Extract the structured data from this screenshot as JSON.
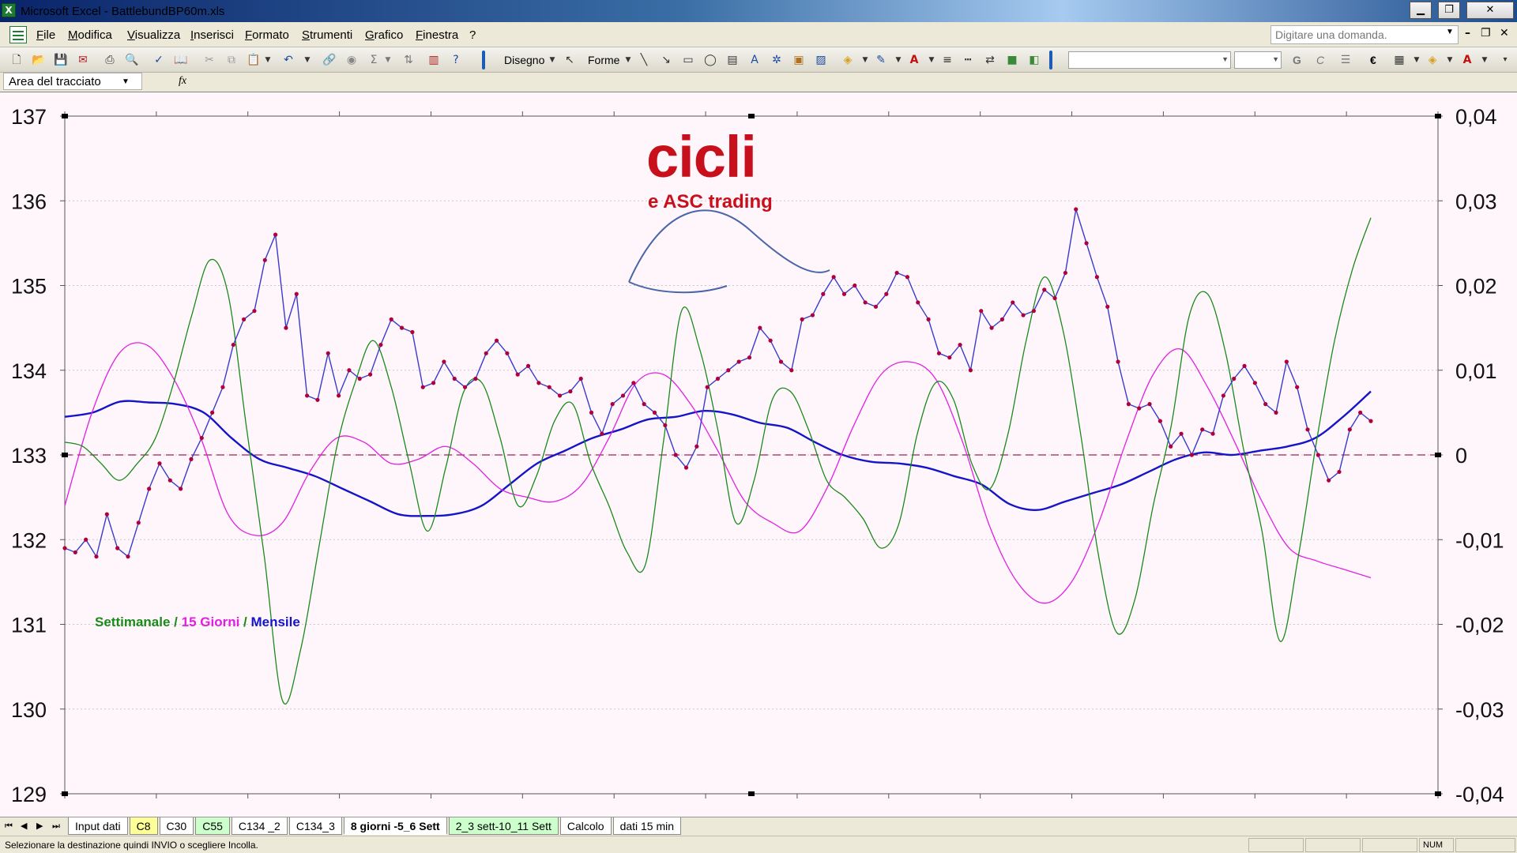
{
  "window": {
    "app_title": "Microsoft Excel - BattlebundBP60m.xls",
    "minimize": "▁",
    "restore": "❐",
    "close": "✕"
  },
  "menu": {
    "items": [
      "File",
      "Modifica",
      "Visualizza",
      "Inserisci",
      "Formato",
      "Strumenti",
      "Grafico",
      "Finestra",
      "?"
    ],
    "ask_placeholder": "Digitare una domanda."
  },
  "toolbar": {
    "drawing_label": "Disegno",
    "shapes_label": "Forme",
    "bold_label": "G",
    "italic_label": "C",
    "euro_label": "€"
  },
  "formula_bar": {
    "name_box": "Area del tracciato",
    "fx": "fx"
  },
  "chart_data": {
    "type": "line",
    "logo_text": "cicli",
    "logo_subtitle": "e ASC trading",
    "legend_parts": [
      {
        "text": "Settimanale",
        "color": "#1a8a1a"
      },
      {
        "text": " / ",
        "color": "#1a8a1a"
      },
      {
        "text": "15 Giorni",
        "color": "#e020e0"
      },
      {
        "text": " / ",
        "color": "#1a8a1a"
      },
      {
        "text": "Mensile",
        "color": "#1414c8"
      }
    ],
    "y_left": {
      "min": 129,
      "max": 137,
      "ticks": [
        "137",
        "136",
        "135",
        "134",
        "133",
        "132",
        "131",
        "130",
        "129"
      ]
    },
    "y_right": {
      "min": -0.04,
      "max": 0.04,
      "ticks": [
        "0,04",
        "0,03",
        "0,02",
        "0,01",
        "0",
        "-0,01",
        "-0,02",
        "-0,03",
        "-0,04"
      ]
    },
    "grid": true,
    "price": [
      131.9,
      131.85,
      132,
      131.8,
      132.3,
      131.9,
      131.8,
      132.2,
      132.6,
      132.9,
      132.7,
      132.6,
      132.95,
      133.2,
      133.5,
      133.8,
      134.3,
      134.6,
      134.7,
      135.3,
      135.6,
      134.5,
      134.9,
      133.7,
      133.65,
      134.2,
      133.7,
      134.0,
      133.9,
      133.95,
      134.3,
      134.6,
      134.5,
      134.45,
      133.8,
      133.85,
      134.1,
      133.9,
      133.8,
      133.9,
      134.2,
      134.35,
      134.2,
      133.95,
      134.05,
      133.85,
      133.8,
      133.7,
      133.75,
      133.9,
      133.5,
      133.25,
      133.6,
      133.7,
      133.85,
      133.6,
      133.5,
      133.35,
      133.0,
      132.85,
      133.1,
      133.8,
      133.9,
      134.0,
      134.1,
      134.15,
      134.5,
      134.35,
      134.1,
      134.0,
      134.6,
      134.65,
      134.9,
      135.1,
      134.9,
      135.0,
      134.8,
      134.75,
      134.9,
      135.15,
      135.1,
      134.8,
      134.6,
      134.2,
      134.15,
      134.3,
      134.0,
      134.7,
      134.5,
      134.6,
      134.8,
      134.65,
      134.7,
      134.95,
      134.85,
      135.15,
      135.9,
      135.5,
      135.1,
      134.75,
      134.1,
      133.6,
      133.55,
      133.6,
      133.4,
      133.1,
      133.25,
      133.0,
      133.3,
      133.25,
      133.7,
      133.9,
      134.05,
      133.85,
      133.6,
      133.5,
      134.1,
      133.8,
      133.3,
      133.0,
      132.7,
      132.8,
      133.3,
      133.5,
      133.4
    ],
    "weekly_cycle": [
      0.0015,
      0.001,
      -0.001,
      -0.003,
      -0.001,
      0.002,
      0.0085,
      0.0165,
      0.023,
      0.019,
      0.0035,
      -0.012,
      -0.029,
      -0.023,
      -0.011,
      0.001,
      0.0085,
      0.0135,
      0.008,
      -0.001,
      -0.009,
      -0.0015,
      0.0075,
      0.0085,
      0.002,
      -0.006,
      -0.0025,
      0.004,
      0.006,
      -0.001,
      -0.006,
      -0.0115,
      -0.013,
      0.0015,
      0.017,
      0.0125,
      0.003,
      -0.008,
      -0.003,
      0.0065,
      0.0075,
      0.003,
      -0.003,
      -0.005,
      -0.0075,
      -0.011,
      -0.008,
      0.0025,
      0.0085,
      0.0065,
      -0.001,
      -0.004,
      0.0025,
      0.0135,
      0.021,
      0.015,
      0.0025,
      -0.012,
      -0.021,
      -0.017,
      -0.006,
      0.0035,
      0.0165,
      0.019,
      0.012,
      0.0005,
      -0.009,
      -0.022,
      -0.012,
      0.0015,
      0.0135,
      0.022,
      0.028
    ],
    "fifteen_day_cycle": [
      -0.006,
      0.005,
      0.012,
      0.013,
      0.009,
      0.002,
      -0.007,
      -0.0095,
      -0.008,
      -0.002,
      0.002,
      0.0015,
      -0.001,
      -0.0005,
      0.001,
      -0.001,
      -0.004,
      -0.005,
      -0.0055,
      -0.0035,
      0.002,
      0.0085,
      0.0095,
      0.006,
      0.0005,
      -0.0055,
      -0.008,
      -0.009,
      -0.004,
      0.0035,
      0.0095,
      0.011,
      0.009,
      0.0015,
      -0.0085,
      -0.015,
      -0.0175,
      -0.015,
      -0.008,
      0.0015,
      0.0095,
      0.0125,
      0.008,
      0.0015,
      -0.0055,
      -0.011,
      -0.0125,
      -0.0135,
      -0.0145
    ],
    "monthly_cycle": [
      0.0045,
      0.005,
      0.0063,
      0.0062,
      0.006,
      0.005,
      0.002,
      -0.0005,
      -0.0015,
      -0.0025,
      -0.004,
      -0.0055,
      -0.007,
      -0.0072,
      -0.007,
      -0.006,
      -0.0035,
      -0.001,
      0.0005,
      0.002,
      0.003,
      0.0042,
      0.0045,
      0.0052,
      0.0048,
      0.0038,
      0.0032,
      0.0015,
      0.0,
      -0.0008,
      -0.001,
      -0.0015,
      -0.0025,
      -0.0035,
      -0.0058,
      -0.0065,
      -0.0055,
      -0.0045,
      -0.0035,
      -0.002,
      -0.0005,
      0.0003,
      0.0,
      0.0005,
      0.001,
      0.002,
      0.0045,
      0.0075
    ]
  },
  "sheet_tabs": [
    {
      "label": "Input dati",
      "style": "normal"
    },
    {
      "label": "C8",
      "style": "yellow"
    },
    {
      "label": "C30",
      "style": "normal"
    },
    {
      "label": "C55",
      "style": "green"
    },
    {
      "label": "C134 _2",
      "style": "normal"
    },
    {
      "label": "C134_3",
      "style": "normal"
    },
    {
      "label": "8 giorni -5_6 Sett",
      "style": "active"
    },
    {
      "label": "2_3 sett-10_11 Sett",
      "style": "green"
    },
    {
      "label": "Calcolo",
      "style": "normal"
    },
    {
      "label": "dati 15 min",
      "style": "normal"
    }
  ],
  "status": {
    "message": "Selezionare la destinazione quindi INVIO o scegliere Incolla.",
    "num": "NUM"
  },
  "colors": {
    "price_line": "#3a3acd",
    "price_marker": "#b0003a",
    "weekly": "#1a8a1a",
    "fifteen_day": "#e020e0",
    "monthly": "#1414c8",
    "logo_red": "#c8101c"
  }
}
